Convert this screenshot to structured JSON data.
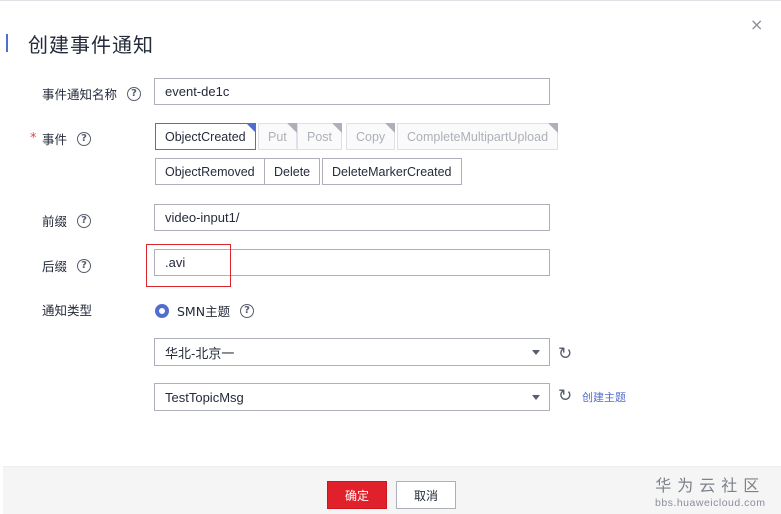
{
  "dialog": {
    "title": "创建事件通知",
    "close_glyph": "×"
  },
  "form": {
    "name": {
      "label": "事件通知名称",
      "value": "event-de1c"
    },
    "events": {
      "label": "事件",
      "required_mark": "*",
      "options": [
        {
          "label": "ObjectCreated",
          "state": "selected"
        },
        {
          "label": "Put",
          "state": "disabled-selected"
        },
        {
          "label": "Post",
          "state": "disabled-selected"
        },
        {
          "label": "Copy",
          "state": "disabled-selected"
        },
        {
          "label": "CompleteMultipartUpload",
          "state": "disabled-selected"
        },
        {
          "label": "ObjectRemoved",
          "state": "unselected"
        },
        {
          "label": "Delete",
          "state": "unselected"
        },
        {
          "label": "DeleteMarkerCreated",
          "state": "unselected"
        }
      ]
    },
    "prefix": {
      "label": "前缀",
      "value": "video-input1/"
    },
    "suffix": {
      "label": "后缀",
      "value": ".avi"
    },
    "notify_type": {
      "label": "通知类型",
      "option": "SMN主题",
      "selected": true
    },
    "region_select": {
      "value": "华北-北京一"
    },
    "topic_select": {
      "value": "TestTopicMsg"
    },
    "create_topic_link": "创建主题"
  },
  "footer": {
    "confirm_label": "确定",
    "cancel_label": "取消"
  },
  "watermark": {
    "title": "华为云社区",
    "url": "bbs.huaweicloud.com"
  },
  "colors": {
    "accent": "#526ecc",
    "primary_button": "#e0202b",
    "highlight": "#d9252b"
  },
  "icons": {
    "help": "question-circle-icon",
    "refresh": "refresh-icon",
    "dropdown": "chevron-down-icon",
    "close": "close-icon"
  }
}
